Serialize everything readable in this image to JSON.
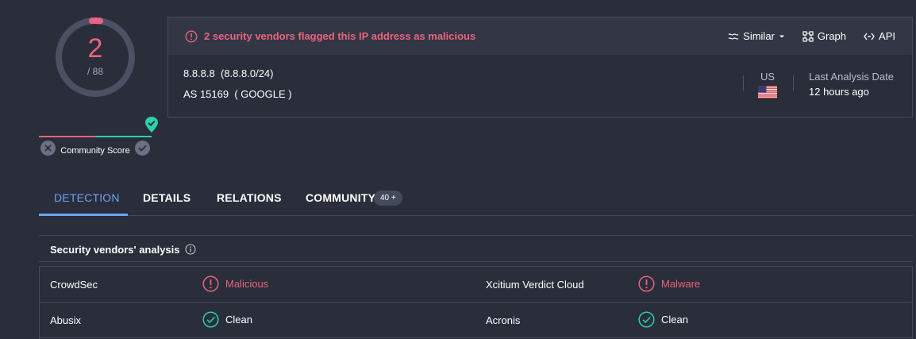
{
  "score": {
    "detections": "2",
    "total": "/ 88",
    "malicious_fraction": 0.0227
  },
  "community": {
    "label": "Community Score"
  },
  "header": {
    "alert": "2 security vendors flagged this IP address as malicious",
    "actions": {
      "similar": "Similar",
      "graph": "Graph",
      "api": "API"
    },
    "ip": "8.8.8.8",
    "network": "(8.8.8.0/24)",
    "as_number": "AS 15169",
    "as_owner": "( GOOGLE )",
    "country": "US",
    "last_analysis_label": "Last Analysis Date",
    "last_analysis_value": "12 hours ago"
  },
  "tabs": [
    {
      "label": "DETECTION"
    },
    {
      "label": "DETAILS"
    },
    {
      "label": "RELATIONS"
    },
    {
      "label": "COMMUNITY"
    }
  ],
  "community_badge": "40 +",
  "vendors": {
    "title": "Security vendors' analysis",
    "rows": [
      {
        "left": {
          "vendor": "CrowdSec",
          "result": "Malicious",
          "status": "malicious"
        },
        "right": {
          "vendor": "Xcitium Verdict Cloud",
          "result": "Malware",
          "status": "malicious"
        }
      },
      {
        "left": {
          "vendor": "Abusix",
          "result": "Clean",
          "status": "clean"
        },
        "right": {
          "vendor": "Acronis",
          "result": "Clean",
          "status": "clean"
        }
      }
    ]
  },
  "colors": {
    "malicious": "#e9647e",
    "clean": "#2ad1a8",
    "accent": "#6da3f5",
    "background": "#2a2d3a"
  },
  "icons": [
    "alert-circle-icon",
    "similar-icon",
    "graph-icon",
    "api-icon",
    "us-flag-icon",
    "info-icon",
    "malicious-icon",
    "clean-check-icon",
    "close-icon",
    "check-icon",
    "community-pin-icon"
  ]
}
